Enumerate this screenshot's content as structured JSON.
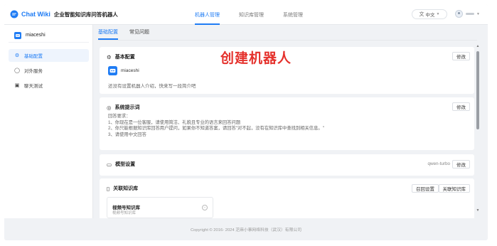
{
  "header": {
    "app_name": "Chat Wiki",
    "app_subtitle": "企业智能知识库问答机器人",
    "nav": [
      {
        "label": "机器人管理",
        "active": true
      },
      {
        "label": "知识库管理",
        "active": false
      },
      {
        "label": "系统管理",
        "active": false
      }
    ],
    "language": "中文",
    "brand_color": "#1f7cf4"
  },
  "sidebar": {
    "bot_name": "miaceshi",
    "menu": [
      {
        "label": "基础配置",
        "icon": "gear-icon",
        "active": true
      },
      {
        "label": "对外服务",
        "icon": "service-icon",
        "active": false
      },
      {
        "label": "聊天测试",
        "icon": "chat-icon",
        "active": false
      }
    ]
  },
  "tabs": [
    {
      "label": "基础配置",
      "active": true
    },
    {
      "label": "常见问题",
      "active": false
    }
  ],
  "overlay_title": "创建机器人",
  "basic_config": {
    "title": "基本配置",
    "edit_label": "修改",
    "bot_name": "miaceshi",
    "description": "还没有设置机器人介绍，快来写一段简介吧"
  },
  "system_prompt": {
    "title": "系统提示词",
    "edit_label": "修改",
    "lines": [
      "回答要求：",
      "1、你现在是一位客服，请使用简洁、礼貌且专业的语言来回答问题",
      "2、你只能根据知识库回答用户提问，如果你不知道答案，请回答\"对不起，没有在知识库中查找到相关信息。\"",
      "3、请使用中文回答"
    ]
  },
  "model_settings": {
    "title": "模型设置",
    "model": "qwen-turbo",
    "edit_label": "修改"
  },
  "linked_kb": {
    "title": "关联知识库",
    "recall_settings_label": "召回设置",
    "link_kb_label": "关联知识库",
    "items": [
      {
        "name": "视频号知识库",
        "subtitle": "视频号知识库"
      }
    ]
  },
  "footer": "Copyright © 2016- 2024 芝麻小事网络科技（武汉）有限公司"
}
